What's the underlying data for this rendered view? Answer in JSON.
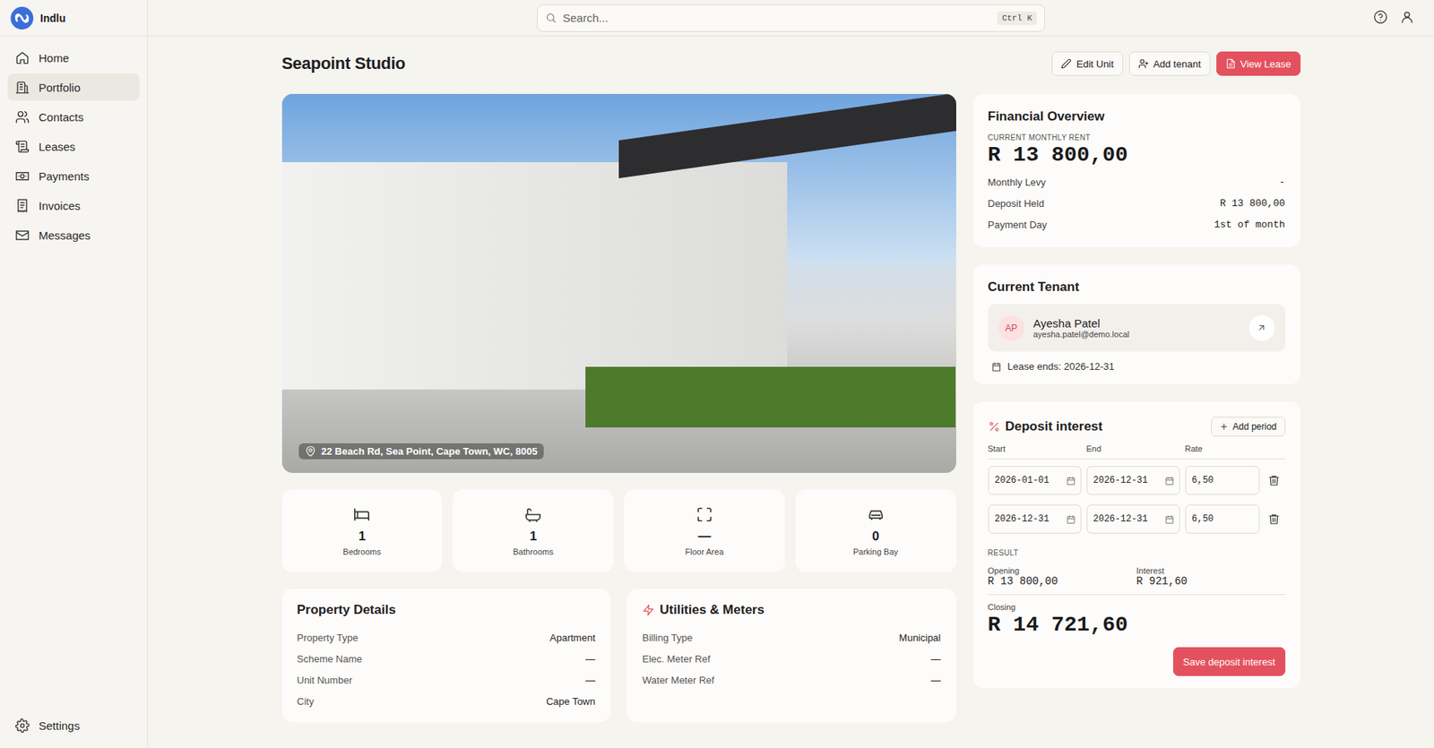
{
  "app": {
    "name": "Indlu"
  },
  "search": {
    "placeholder": "Search...",
    "shortcut": "Ctrl K"
  },
  "sidebar": {
    "items": [
      {
        "label": "Home",
        "selected": false
      },
      {
        "label": "Portfolio",
        "selected": true
      },
      {
        "label": "Contacts",
        "selected": false
      },
      {
        "label": "Leases",
        "selected": false
      },
      {
        "label": "Payments",
        "selected": false
      },
      {
        "label": "Invoices",
        "selected": false
      },
      {
        "label": "Messages",
        "selected": false
      }
    ],
    "footer": {
      "label": "Settings",
      "selected": false
    }
  },
  "page": {
    "title": "Seapoint Studio"
  },
  "actions": [
    {
      "label": "Edit Unit",
      "kind": "outline"
    },
    {
      "label": "Add tenant",
      "kind": "outline"
    },
    {
      "label": "View Lease",
      "kind": "primary"
    }
  ],
  "photo": {
    "address": "22 Beach Rd, Sea Point, Cape Town, WC, 8005"
  },
  "stats": [
    {
      "value": "1",
      "label": "Bedrooms"
    },
    {
      "value": "1",
      "label": "Bathrooms"
    },
    {
      "value": "—",
      "label": "Floor Area"
    },
    {
      "value": "0",
      "label": "Parking Bay"
    }
  ],
  "property_details": {
    "title": "Property Details",
    "rows": [
      {
        "label": "Property Type",
        "value": "Apartment"
      },
      {
        "label": "Scheme Name",
        "value": "—"
      },
      {
        "label": "Unit Number",
        "value": "—"
      },
      {
        "label": "City",
        "value": "Cape Town"
      }
    ]
  },
  "utilities": {
    "title": "Utilities & Meters",
    "rows": [
      {
        "label": "Billing Type",
        "value": "Municipal"
      },
      {
        "label": "Elec. Meter Ref",
        "value": "—"
      },
      {
        "label": "Water Meter Ref",
        "value": "—"
      }
    ]
  },
  "financial": {
    "title": "Financial Overview",
    "rent_label": "CURRENT MONTHLY RENT",
    "rent": "R 13 800,00",
    "rows": [
      {
        "label": "Monthly Levy",
        "value": "-"
      },
      {
        "label": "Deposit Held",
        "value": "R 13 800,00"
      },
      {
        "label": "Payment Day",
        "value": "1st of month"
      }
    ]
  },
  "tenant": {
    "title": "Current Tenant",
    "initials": "AP",
    "name": "Ayesha Patel",
    "email": "ayesha.patel@demo.local",
    "lease_end": "Lease ends: 2026-12-31"
  },
  "deposit_interest": {
    "title": "Deposit interest",
    "add_label": "Add period",
    "columns": [
      "Start",
      "End",
      "Rate"
    ],
    "periods": [
      {
        "start": "2026-01-01",
        "end": "2026-12-31",
        "rate": "6,50"
      },
      {
        "start": "2026-12-31",
        "end": "2026-12-31",
        "rate": "6,50"
      }
    ],
    "result_label": "RESULT",
    "opening_label": "Opening",
    "opening": "R 13 800,00",
    "interest_label": "Interest",
    "interest": "R 921,60",
    "closing_label": "Closing",
    "closing": "R 14 721,60",
    "save_label": "Save deposit interest"
  }
}
